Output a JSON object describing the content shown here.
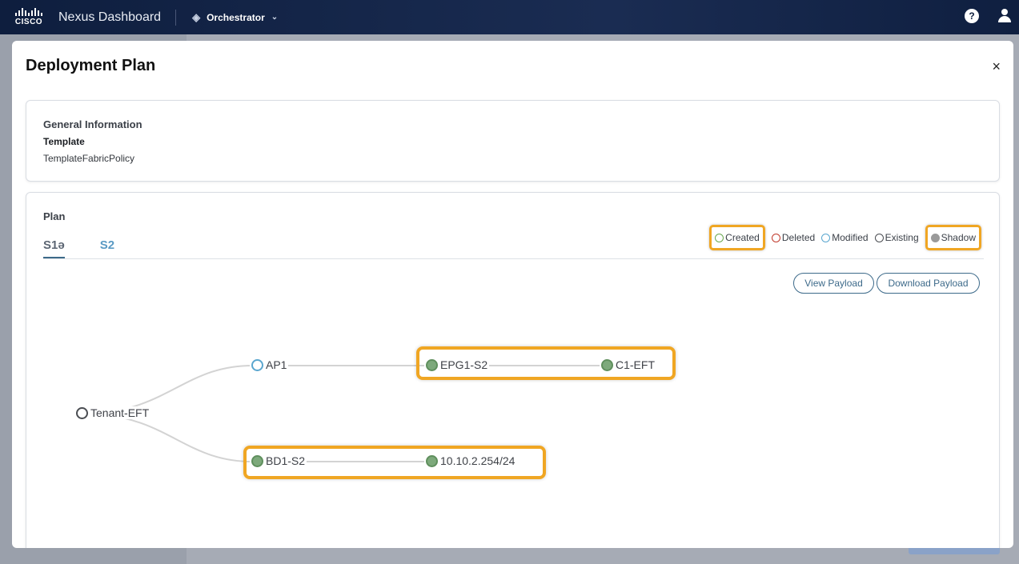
{
  "header": {
    "logo_text": "CISCO",
    "product_name": "Nexus Dashboard",
    "app_switcher_label": "Orchestrator",
    "help_label": "?"
  },
  "modal": {
    "title": "Deployment Plan",
    "close_label": "×",
    "general": {
      "heading": "General Information",
      "template_label": "Template",
      "template_value": "TemplateFabricPolicy"
    },
    "plan": {
      "heading": "Plan",
      "tabs": [
        {
          "label": "S1ə",
          "active": true
        },
        {
          "label": "S2",
          "active": false
        }
      ],
      "legend": [
        {
          "label": "Created",
          "color": "#6aa84f",
          "filled": false,
          "highlighted": true
        },
        {
          "label": "Deleted",
          "color": "#c0392b",
          "filled": false,
          "highlighted": false
        },
        {
          "label": "Modified",
          "color": "#5aa6cf",
          "filled": false,
          "highlighted": false
        },
        {
          "label": "Existing",
          "color": "#4a4d52",
          "filled": false,
          "highlighted": false
        },
        {
          "label": "Shadow",
          "color": "#9a9a9a",
          "filled": true,
          "highlighted": true
        }
      ],
      "buttons": {
        "view_payload": "View Payload",
        "download_payload": "Download Payload"
      },
      "tree": {
        "root": {
          "label": "Tenant-EFT",
          "state": "existing"
        },
        "ap": {
          "label": "AP1",
          "state": "modified"
        },
        "epg": {
          "label": "EPG1-S2",
          "state": "shadow"
        },
        "contract": {
          "label": "C1-EFT",
          "state": "shadow"
        },
        "bd": {
          "label": "BD1-S2",
          "state": "shadow"
        },
        "subnet": {
          "label": "10.10.2.254/24",
          "state": "shadow"
        }
      }
    }
  },
  "colors": {
    "highlight": "#f0a623",
    "accent": "#3d6a8a",
    "navbar": "#0e1e3e"
  }
}
